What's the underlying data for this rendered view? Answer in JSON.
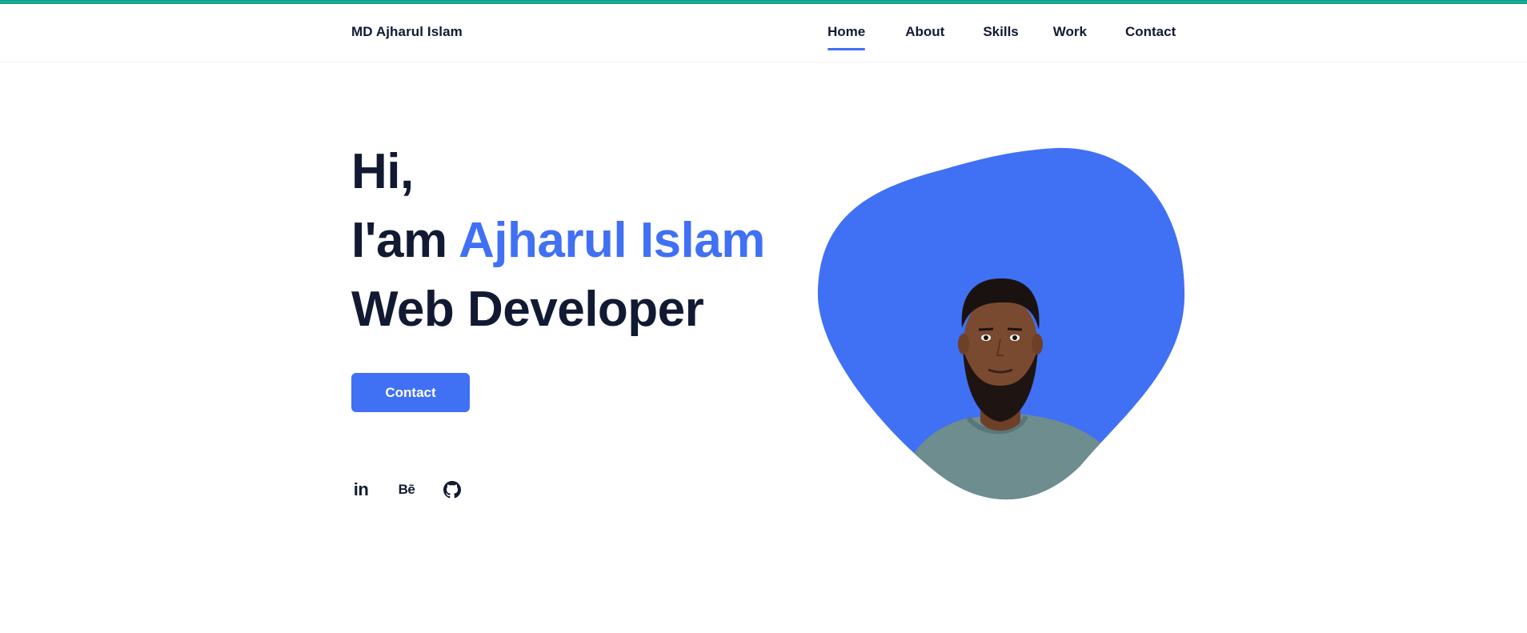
{
  "header": {
    "brand": "MD Ajharul Islam",
    "nav": [
      {
        "label": "Home",
        "active": true
      },
      {
        "label": "About",
        "active": false
      },
      {
        "label": "Skills",
        "active": false
      },
      {
        "label": "Work",
        "active": false
      },
      {
        "label": "Contact",
        "active": false
      }
    ]
  },
  "hero": {
    "line1": "Hi,",
    "line2_prefix": "I'am ",
    "line2_name": "Ajharul Islam",
    "line3": "Web Developer",
    "button_label": "Contact"
  },
  "social": {
    "linkedin_glyph": "in",
    "behance_glyph": "Bē"
  },
  "colors": {
    "accent": "#4070f4",
    "text": "#121a33",
    "top_bar": "#0f9f8a",
    "shirt": "#6d8d8f",
    "skin": "#7a4a30",
    "hair": "#1a1210"
  },
  "icons": [
    "linkedin-icon",
    "behance-icon",
    "github-icon"
  ]
}
